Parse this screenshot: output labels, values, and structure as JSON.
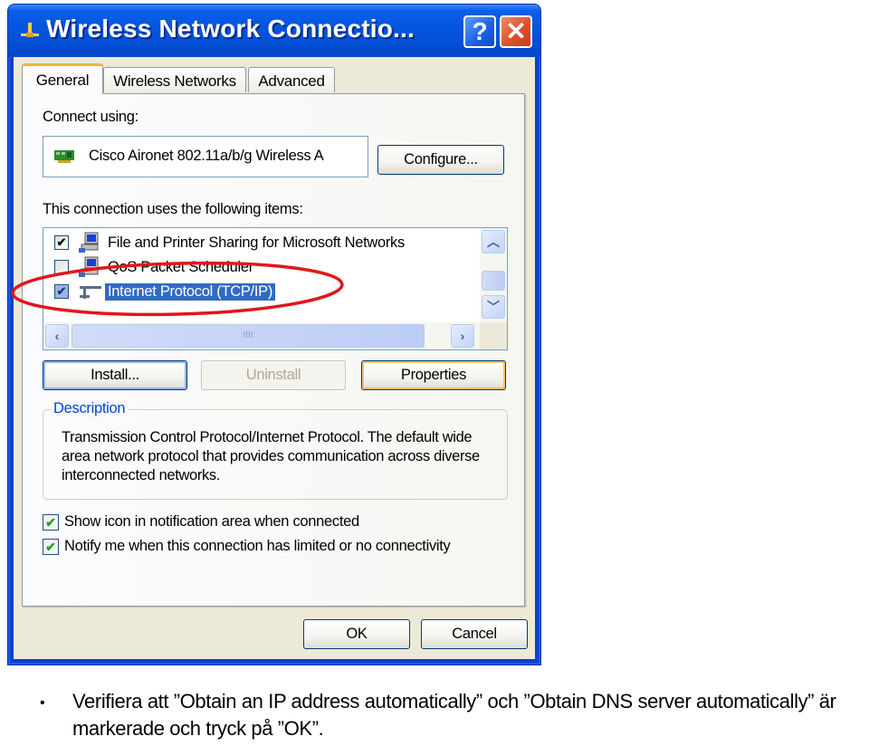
{
  "window": {
    "title": "Wireless Network Connectio...",
    "help_label": "?",
    "close_label": "✕",
    "title_icon": "network-connection-icon"
  },
  "tabs": [
    {
      "label": "General",
      "active": true
    },
    {
      "label": "Wireless Networks",
      "active": false
    },
    {
      "label": "Advanced",
      "active": false
    }
  ],
  "general": {
    "connect_using_label": "Connect using:",
    "adapter_name": "Cisco Aironet 802.11a/b/g Wireless A",
    "adapter_icon": "network-card-icon",
    "configure_label": "Configure...",
    "items_label": "This connection uses the following items:",
    "items": [
      {
        "label": "File and Printer Sharing for Microsoft Networks",
        "checked": true,
        "check": "✔",
        "icon": "computer-icon",
        "selected": false
      },
      {
        "label": "QoS Packet Scheduler",
        "checked": false,
        "check": "",
        "icon": "computer-icon",
        "selected": false
      },
      {
        "label": "Internet Protocol (TCP/IP)",
        "checked": true,
        "check": "✔",
        "icon": "protocol-icon",
        "selected": true
      }
    ],
    "scroll": {
      "up": "︿",
      "down": "﹀",
      "left": "‹",
      "right": "›",
      "grip": "IIII"
    },
    "install_label": "Install...",
    "uninstall_label": "Uninstall",
    "properties_label": "Properties",
    "description_title": "Description",
    "description_text": "Transmission Control Protocol/Internet Protocol. The default wide area network protocol that provides communication across diverse interconnected networks.",
    "options": [
      {
        "label": "Show icon in notification area when connected",
        "checked": true,
        "check": "✔"
      },
      {
        "label": "Notify me when this connection has limited or no connectivity",
        "checked": true,
        "check": "✔"
      }
    ]
  },
  "footer": {
    "ok_label": "OK",
    "cancel_label": "Cancel"
  },
  "annotation": {
    "highlight_color": "#e3151a",
    "highlighted_item": "Internet Protocol (TCP/IP)"
  },
  "instruction": {
    "bullet": "•",
    "text": "Verifiera att ”Obtain an IP address automatically” och ”Obtain DNS server automatically” är markerade och tryck på ”OK”."
  }
}
